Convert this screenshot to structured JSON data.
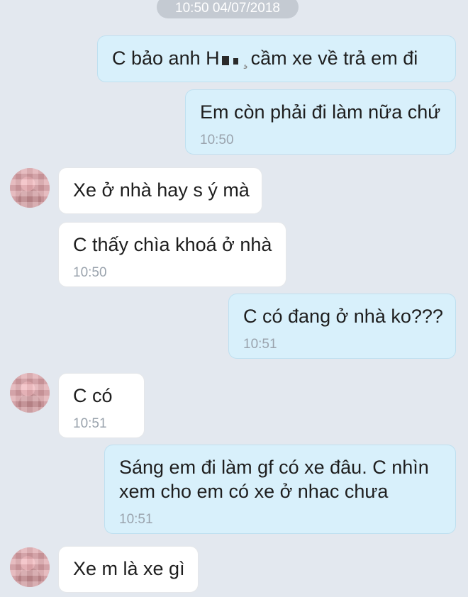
{
  "date_separator": "10:50 04/07/2018",
  "messages": [
    {
      "id": "m1",
      "side": "out",
      "pre": "C bảo anh H",
      "post": "cầm xe về trả em đi",
      "time": ""
    },
    {
      "id": "m2",
      "side": "out",
      "text": "Em còn phải đi làm nữa chứ",
      "time": "10:50"
    },
    {
      "id": "m3",
      "side": "in",
      "text": "Xe ở nhà hay s ý mà",
      "time": ""
    },
    {
      "id": "m4",
      "side": "in",
      "text": "C thấy chìa khoá ở nhà",
      "time": "10:50"
    },
    {
      "id": "m5",
      "side": "out",
      "text": "C có đang ở nhà ko???",
      "time": "10:51"
    },
    {
      "id": "m6",
      "side": "in",
      "text": "C có",
      "time": "10:51"
    },
    {
      "id": "m7",
      "side": "out",
      "line1": "Sáng em đi làm gf có xe đâu. C nhìn",
      "line2": "xem cho em có xe ở nhac chưa",
      "time": "10:51"
    },
    {
      "id": "m8",
      "side": "in",
      "text": "Xe m là xe gì",
      "time": ""
    }
  ],
  "colors": {
    "background": "#e3e8ef",
    "outgoing_bubble": "#d8f0fb",
    "incoming_bubble": "#ffffff",
    "timestamp_text": "#9aa3ad"
  }
}
